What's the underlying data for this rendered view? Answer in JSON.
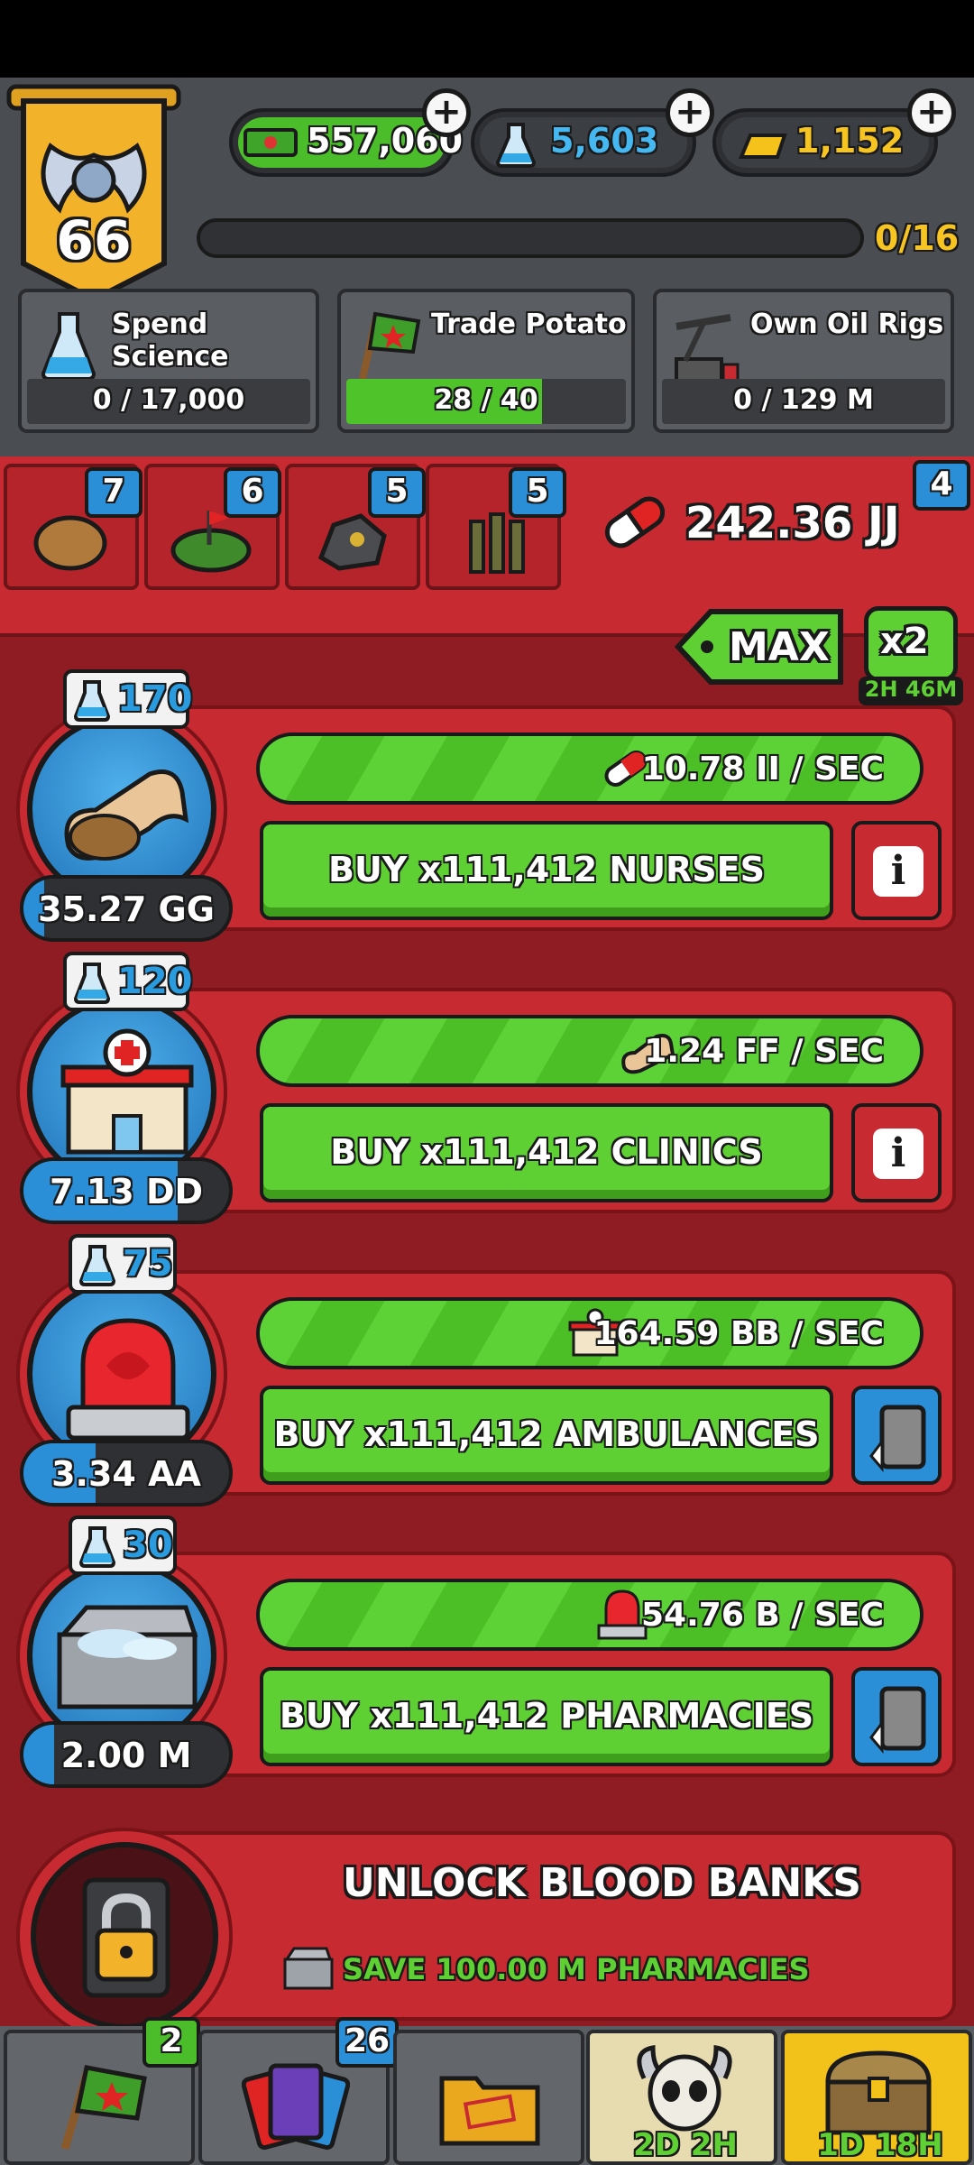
{
  "player": {
    "level": "66"
  },
  "resources": {
    "cash": {
      "value": "557,060",
      "icon": "cash-icon"
    },
    "science": {
      "value": "5,603",
      "icon": "flask-icon"
    },
    "gold": {
      "value": "1,152",
      "icon": "gold-bar-icon"
    }
  },
  "xp_progress": {
    "text": "0/16",
    "fraction": 0.0
  },
  "tasks": [
    {
      "title_line1": "Spend",
      "title_line2": "Science",
      "progress": "0 / 17,000",
      "fraction": 0.0
    },
    {
      "title_line1": "Trade Potato",
      "title_line2": "",
      "progress": "28 / 40",
      "fraction": 0.7
    },
    {
      "title_line1": "Own Oil Rigs",
      "title_line2": "",
      "progress": "0 / 129 M",
      "fraction": 0.0
    }
  ],
  "categories": [
    {
      "name": "potato-icon",
      "badge": "7"
    },
    {
      "name": "landmine-icon",
      "badge": "6"
    },
    {
      "name": "ore-icon",
      "badge": "5"
    },
    {
      "name": "bullets-icon",
      "badge": "5"
    }
  ],
  "currency": {
    "value": "242.36 JJ",
    "badge": "4",
    "icon": "pill-icon"
  },
  "multiplier": {
    "max_label": "MAX",
    "boost_label": "x2",
    "boost_timer": "2H 46M"
  },
  "producers": [
    {
      "name": "nurses",
      "science": "170",
      "cost": "35.27 GG",
      "cost_fraction": 0.1,
      "rate": "10.78 II / SEC",
      "buy": "BUY x111,412 NURSES",
      "action": "info"
    },
    {
      "name": "clinics",
      "science": "120",
      "cost": "7.13 DD",
      "cost_fraction": 0.75,
      "rate": "1.24 FF / SEC",
      "buy": "BUY x111,412 CLINICS",
      "action": "info"
    },
    {
      "name": "ambulances",
      "science": "75",
      "cost": "3.34 AA",
      "cost_fraction": 0.35,
      "rate": "164.59 BB / SEC",
      "buy": "BUY x111,412 AMBULANCES",
      "action": "swap"
    },
    {
      "name": "pharmacies",
      "science": "30",
      "cost": "2.00 M",
      "cost_fraction": 0.15,
      "rate": "54.76 B / SEC",
      "buy": "BUY x111,412 PHARMACIES",
      "action": "swap"
    }
  ],
  "unlock": {
    "title": "UNLOCK BLOOD BANKS",
    "subtitle": "SAVE 100.00 M PHARMACIES"
  },
  "bottom_nav": [
    {
      "name": "flag",
      "badge": "2",
      "timer": ""
    },
    {
      "name": "cards",
      "badge": "26",
      "timer": ""
    },
    {
      "name": "folder",
      "badge": "",
      "timer": ""
    },
    {
      "name": "skull-event",
      "badge": "",
      "timer": "2D 2H"
    },
    {
      "name": "chest",
      "badge": "",
      "timer": "1D 18H"
    }
  ]
}
